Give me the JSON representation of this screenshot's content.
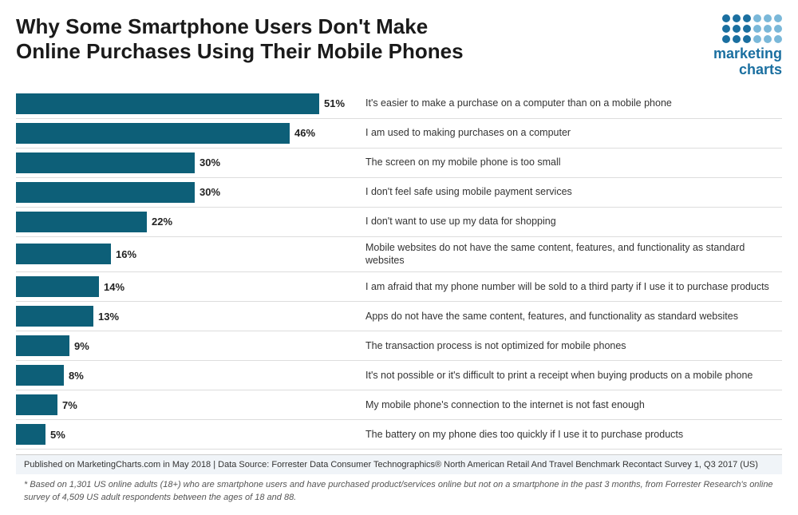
{
  "title": {
    "line1": "Why Some Smartphone Users Don't Make",
    "line2": "Online Purchases Using Their Mobile Phones"
  },
  "logo": {
    "line1": "marketing",
    "line2": "charts"
  },
  "bars": [
    {
      "pct": 51,
      "label": "It's easier to make a purchase on a computer than on a mobile phone",
      "pct_text": "51%"
    },
    {
      "pct": 46,
      "label": "I am used to making purchases on a computer",
      "pct_text": "46%"
    },
    {
      "pct": 30,
      "label": "The screen on my mobile phone is too small",
      "pct_text": "30%"
    },
    {
      "pct": 30,
      "label": "I don't feel safe using mobile payment services",
      "pct_text": "30%"
    },
    {
      "pct": 22,
      "label": "I don't want to use up my data for shopping",
      "pct_text": "22%"
    },
    {
      "pct": 16,
      "label": "Mobile websites do not have the same content, features, and functionality as standard websites",
      "pct_text": "16%"
    },
    {
      "pct": 14,
      "label": "I am afraid that my phone number will be sold to a third party if I use it to purchase products",
      "pct_text": "14%"
    },
    {
      "pct": 13,
      "label": "Apps do not have the same content, features, and functionality as standard websites",
      "pct_text": "13%"
    },
    {
      "pct": 9,
      "label": "The transaction process is not optimized for mobile phones",
      "pct_text": "9%"
    },
    {
      "pct": 8,
      "label": "It's not possible or it's difficult to print a receipt when buying products on a mobile phone",
      "pct_text": "8%"
    },
    {
      "pct": 7,
      "label": "My mobile phone's connection to the internet is not fast enough",
      "pct_text": "7%"
    },
    {
      "pct": 5,
      "label": "The battery on my phone dies too quickly if I use it to purchase products",
      "pct_text": "5%"
    }
  ],
  "max_bar_width": 380,
  "footer_main": "Published on MarketingCharts.com in May 2018 | Data Source: Forrester Data Consumer Technographics® North American Retail And Travel Benchmark Recontact Survey 1, Q3 2017 (US)",
  "footer_note": "* Based on 1,301 US online adults (18+) who are smartphone users and have purchased product/services online but not on a smartphone in the past 3 months, from Forrester Research's online survey of 4,509 US adult respondents between the ages of 18 and 88."
}
